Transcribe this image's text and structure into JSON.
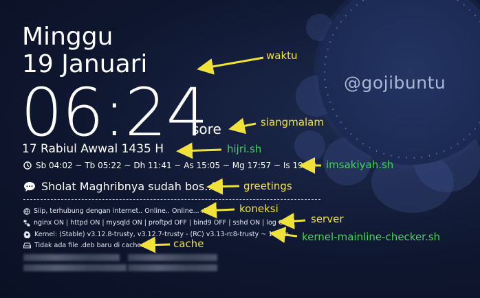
{
  "widget": {
    "day": "Minggu",
    "date": "19 Januari",
    "time": "06:24",
    "period": "sore",
    "hijri": "17 Rabiul Awwal 1435 H",
    "prayer_times": "Sb 04:02 ~ Tb 05:22 ~ Dh 11:41 ~ As 15:05 ~ Mg 17:57 ~ Is 19:12",
    "greeting": "Sholat Maghribnya sudah bos..?",
    "connection": "Siip, terhubung dengan internet.. Online.. Online... :D",
    "server": "nginx ON | httpd ON | mysqld ON | proftpd OFF | bind9 OFF | sshd ON | log OFF",
    "kernel": "Kernel: (Stable) v3.12.8-trusty, v3.12.7-trusty - (RC) v3.13-rc8-trusty ~ 18 Jan",
    "cache": "Tidak ada file .deb baru di cache.."
  },
  "wallpaper": {
    "handle": "@gojibuntu"
  },
  "annotations": {
    "waktu": "waktu",
    "siangmalam": "siangmalam",
    "hijri": "hijri.sh",
    "imsakiyah": "imsakiyah.sh",
    "greetings": "greetings",
    "koneksi": "koneksi",
    "server": "server",
    "kernel": "kernel-mainline-checker.sh",
    "cache": "cache"
  },
  "colors": {
    "arrow": "#f1e23a",
    "label_yellow": "#f1e23a",
    "label_green": "#47d35b",
    "background": "#0f1730"
  },
  "icons": {
    "prayer": "clock-icon",
    "greeting": "speech-bubble-icon",
    "connection": "globe-icon",
    "server": "network-icon",
    "kernel": "gear-icon",
    "cache": "drive-icon"
  }
}
